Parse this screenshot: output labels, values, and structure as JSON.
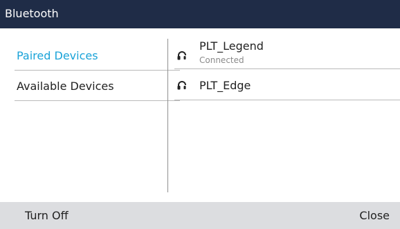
{
  "window": {
    "title": "Bluetooth"
  },
  "sidebar": {
    "items": [
      {
        "label": "Paired Devices",
        "selected": true
      },
      {
        "label": "Available Devices",
        "selected": false
      }
    ]
  },
  "devices": [
    {
      "name": "PLT_Legend",
      "status": "Connected",
      "icon": "headset-icon"
    },
    {
      "name": "PLT_Edge",
      "status": "",
      "icon": "headset-icon"
    }
  ],
  "softkeys": {
    "left": "Turn Off",
    "right": "Close"
  },
  "colors": {
    "title_bar": "#1f2c47",
    "accent": "#1aa3d8",
    "softkey_bar": "#dcdde0",
    "status_text": "#8a8a8a"
  }
}
